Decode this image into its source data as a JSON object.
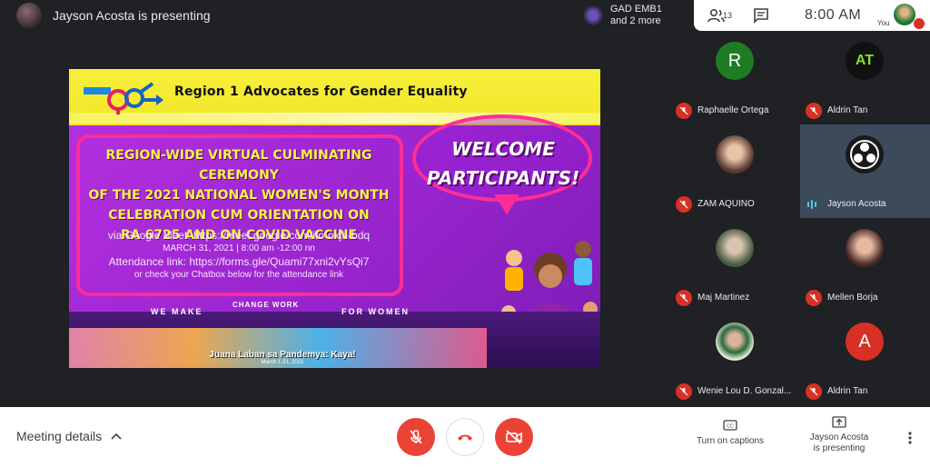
{
  "presenter_bar": {
    "title": "Jayson Acosta is presenting"
  },
  "top_participants": {
    "name": "GAD EMB1",
    "more": "and 2 more"
  },
  "toolbar": {
    "people_count": "13",
    "clock": "8:00 AM",
    "you_label": "You"
  },
  "slide": {
    "org_title": "Region 1 Advocates for Gender Equality",
    "headline_lines": [
      "REGION-WIDE VIRTUAL CULMINATING CEREMONY",
      "OF THE 2021 NATIONAL WOMEN'S MONTH",
      "CELEBRATION CUM  ORIENTATION ON",
      "RA 6725 AND ON COVID VACCINE"
    ],
    "meet_line": "via Google Meet: https://meet.google.com/ifo-okjh-bdq",
    "date_line": "MARCH 31, 2021 | 8:00 am -12:00 nn",
    "attendance_line": "Attendance link: https://forms.gle/Quami77xni2vYsQi7",
    "chatbox_line": "or check your Chatbox below  for the attendance link",
    "welcome_line1": "WELCOME",
    "welcome_line2": "PARTICIPANTS!",
    "banner_left": "WE MAKE",
    "banner_mid": "CHANGE WORK",
    "banner_right": "FOR WOMEN",
    "footer_title": "Juana Laban sa Pandemya: Kaya!",
    "footer_date": "March 1-31, 2021"
  },
  "participants": [
    {
      "name": "Raphaelle Ortega",
      "initials": "R",
      "color": "#1e7d22",
      "muted": true
    },
    {
      "name": "Aldrin Tan",
      "initials": "AT",
      "color": "#111111",
      "muted": true
    },
    {
      "name": "ZAM AQUINO",
      "initials": "",
      "color": "#7a5a4a",
      "muted": true
    },
    {
      "name": "Jayson Acosta",
      "initials": "",
      "color": "#1a1a1a",
      "muted": false,
      "speaking": true
    },
    {
      "name": "Maj Martinez",
      "initials": "",
      "color": "#5a6a50",
      "muted": true
    },
    {
      "name": "Mellen Borja",
      "initials": "",
      "color": "#6a4a44",
      "muted": true
    },
    {
      "name": "Wenie Lou D. Gonzal...",
      "initials": "",
      "color": "#2d6b3a",
      "muted": true
    },
    {
      "name": "Aldrin Tan",
      "initials": "A",
      "color": "#d93025",
      "muted": true
    }
  ],
  "bottom": {
    "meeting_details": "Meeting details",
    "captions": "Turn on captions",
    "presenting_line1": "Jayson Acosta",
    "presenting_line2": "is presenting"
  },
  "colors": {
    "danger": "#ea4335",
    "speaking": "#4ecde6",
    "slide_bg": "#a52ad8",
    "slide_header": "#f6ef3a"
  }
}
